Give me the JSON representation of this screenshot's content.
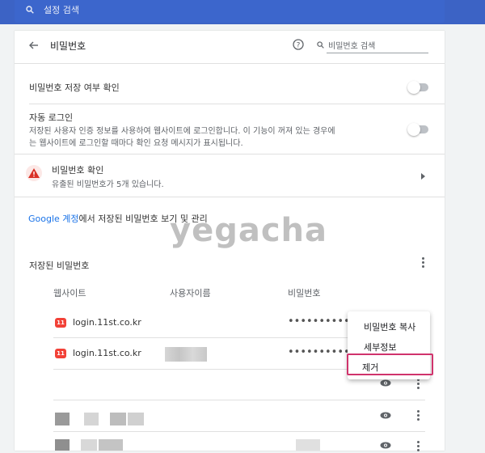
{
  "search": {
    "placeholder": "설정 검색"
  },
  "header": {
    "title": "비밀번호",
    "search_placeholder": "비밀번호 검색"
  },
  "settings": {
    "offer_save": {
      "label": "비밀번호 저장 여부 확인",
      "enabled": false
    },
    "auto_signin": {
      "label": "자동 로그인",
      "description_line1": "저장된 사용자 인증 정보를 사용하여 웹사이트에 로그인합니다. 이 기능이 꺼져 있는 경우에",
      "description_line2": "는 웹사이트에 로그인할 때마다 확인 요청 메시지가 표시됩니다.",
      "enabled": false
    },
    "check": {
      "title": "비밀번호 확인",
      "subtitle": "유출된 비밀번호가 5개 있습니다."
    }
  },
  "google_account": {
    "link": "Google 계정",
    "text": "에서 저장된 비밀번호 보기 및 관리"
  },
  "saved": {
    "title": "저장된 비밀번호",
    "columns": [
      "웹사이트",
      "사용자이름",
      "비밀번호"
    ],
    "rows": [
      {
        "icon_text": "11",
        "site": "login.11st.co.kr",
        "password": "••••••••••"
      },
      {
        "icon_text": "11",
        "site": "login.11st.co.kr",
        "password": "••••••••••"
      }
    ]
  },
  "menu": {
    "items": [
      "비밀번호 복사",
      "세부정보",
      "제거"
    ],
    "highlighted": "제거"
  },
  "watermark": "yegacha",
  "colors": {
    "topbar": "#3c63c5",
    "link": "#1a73e8",
    "warning": "#d93025",
    "highlight": "#d0336c"
  }
}
